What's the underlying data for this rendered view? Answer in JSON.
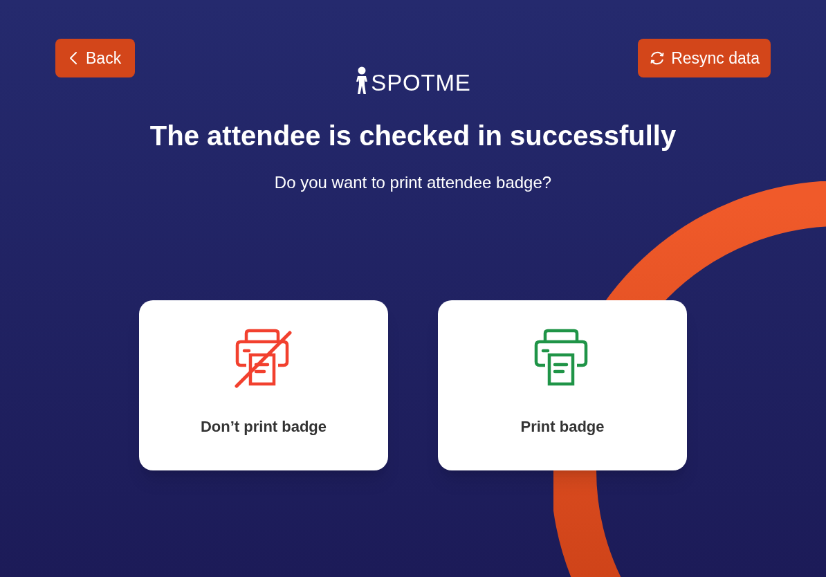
{
  "back_button": {
    "label": "Back"
  },
  "resync_button": {
    "label": "Resync data"
  },
  "logo": {
    "text": "SPOTME"
  },
  "title": "The attendee is checked in successfully",
  "subtitle": "Do you want to print attendee badge?",
  "options": [
    {
      "kind": "no-print",
      "label": "Don’t print badge"
    },
    {
      "kind": "print",
      "label": "Print badge"
    }
  ]
}
